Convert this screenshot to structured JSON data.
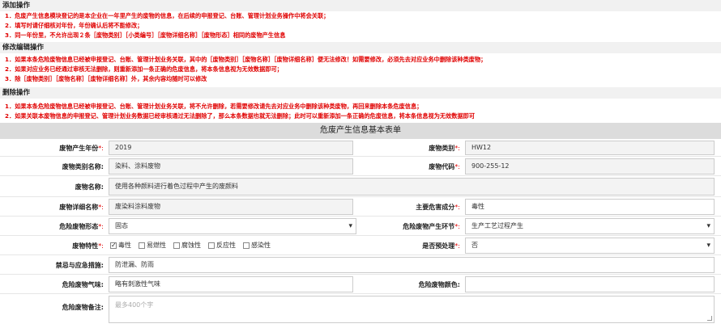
{
  "add_section": {
    "title": "添加操作",
    "lines": [
      "1．危废产生信息模块登记的是本企业在一年里产生的废物的信息，在后续的申报登记、台账、管理计划业务操作中将会关联；",
      "2．填写时请仔细核对年份，年份确认后将不能修改；",
      "3．同一年份里，不允许出现２条［废物类别］［小类编号］［废物详细名称］［废物形态］相同的废物产生信息"
    ]
  },
  "edit_section": {
    "title": "修改编辑操作",
    "lines": [
      "1．如果本条危险废物信息已经被申报登记、台账、管理计划业务关联，其中的［废物类别］［废物名称］［废物详细名称］便无法修改！如需要修改，必须先去对应业务中删除该种类废物；",
      "2．如果对应业务已经通过审核无法删除，则重新添加一条正确的危废信息，将本条信息视为无效数据即可；",
      "3．除［废物类别］［废物名称］［废物详细名称］外，其余内容均随时可以修改"
    ]
  },
  "delete_section": {
    "title": "删除操作",
    "lines": [
      "1．如果本条危险废物信息已经被申报登记、台账、管理计划业务关联，将不允许删除，若需要修改请先去对应业务中删除该种类废物，再回来删除本条危废信息；",
      "2．如果关联本废物信息的申报登记、管理计划业务数据已经审核通过无法删除了，那么本条数据也就无法删除；此时可以重新添加一条正确的危废信息，将本条信息视为无效数据即可"
    ]
  },
  "form": {
    "title": "危废产生信息基本表单",
    "year": {
      "label": "废物产生年份",
      "value": "2019"
    },
    "category": {
      "label": "废物类别",
      "value": "HW12"
    },
    "category_name": {
      "label": "废物类别名称:",
      "value": "染料、涂料废物"
    },
    "code": {
      "label": "废物代码",
      "value": "900-255-12"
    },
    "waste_name": {
      "label": "废物名称:",
      "value": "使用各种颜料进行着色过程中产生的废颜料"
    },
    "detail_name": {
      "label": "废物详细名称",
      "value": "废染料涂料废物"
    },
    "main_component": {
      "label": "主要危害成分",
      "value": "毒性"
    },
    "form_state": {
      "label": "危险废物形态",
      "value": "固态"
    },
    "stage": {
      "label": "危险废物产生环节",
      "value": "生产工艺过程产生"
    },
    "property": {
      "label": "废物特性",
      "options": [
        {
          "label": "毒性",
          "checked": true
        },
        {
          "label": "易燃性",
          "checked": false
        },
        {
          "label": "腐蚀性",
          "checked": false
        },
        {
          "label": "反应性",
          "checked": false
        },
        {
          "label": "感染性",
          "checked": false
        }
      ]
    },
    "pretreat": {
      "label": "是否预处理",
      "value": "否"
    },
    "taboo": {
      "label": "禁忌与应急措施:",
      "value": "防泄漏、防雨"
    },
    "smell": {
      "label": "危险废物气味:",
      "value": "略有刺激性气味"
    },
    "color": {
      "label": "危险废物颜色:",
      "value": ""
    },
    "remark": {
      "label": "危险废物备注:",
      "placeholder": "最多400个字"
    },
    "required_mark": "*:"
  }
}
